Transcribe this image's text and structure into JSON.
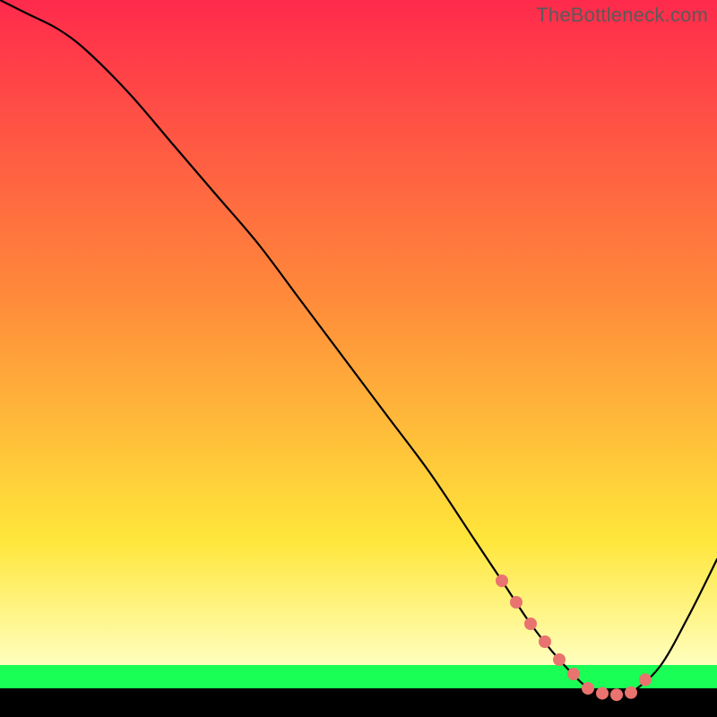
{
  "watermark": "TheBottleneck.com",
  "colors": {
    "red": "#ff2a4c",
    "orange": "#ff8a3a",
    "yellow": "#ffe63a",
    "lightYellow": "#ffffbe",
    "green": "#1aff55",
    "black": "#000000",
    "curve": "#000000",
    "dot": "#e9736f"
  },
  "bands": {
    "top_end_y": 602,
    "lower_end_y": 742,
    "green_end_y": 768,
    "black_end_y": 800
  },
  "chart_data": {
    "type": "line",
    "title": "",
    "xlabel": "",
    "ylabel": "",
    "xlim": [
      0,
      100
    ],
    "ylim": [
      0,
      100
    ],
    "x": [
      0,
      4,
      8,
      12,
      18,
      24,
      30,
      36,
      42,
      48,
      54,
      60,
      66,
      70,
      74,
      78,
      82,
      84,
      86,
      88,
      92,
      96,
      100
    ],
    "values": [
      100,
      98,
      96,
      93,
      87,
      80,
      73,
      66,
      58,
      50,
      42,
      34,
      25,
      19,
      13,
      8,
      4,
      3.3,
      3.1,
      3.4,
      7,
      14,
      22
    ],
    "highlight_x": [
      70,
      72,
      74,
      76,
      78,
      80,
      82,
      84,
      86,
      88,
      90
    ]
  }
}
